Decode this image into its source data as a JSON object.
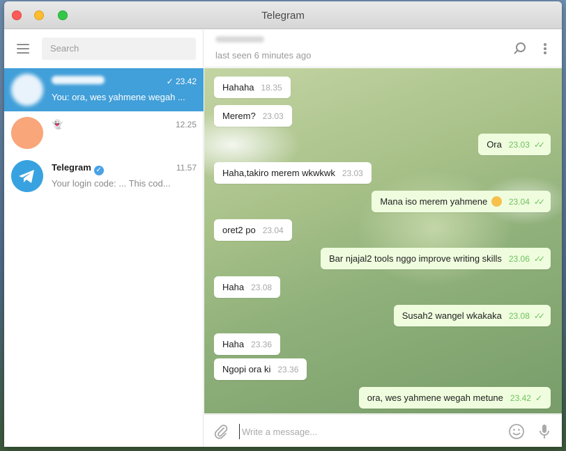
{
  "window": {
    "title": "Telegram"
  },
  "sidebar": {
    "search_placeholder": "Search",
    "chats": [
      {
        "name": "",
        "time": "23.42",
        "preview": "You: ora, wes yahmene wegah ...",
        "active": true,
        "avatar_color": "#ffffff"
      },
      {
        "name": "👻",
        "time": "12.25",
        "preview": "",
        "active": false,
        "avatar_color": "#f8a67a"
      },
      {
        "name": "Telegram",
        "time": "11.57",
        "preview": "Your login code: ...  This cod...",
        "active": false,
        "avatar_color": "#38a2e0"
      }
    ]
  },
  "chat": {
    "peer_status": "last seen 6 minutes ago",
    "messages": [
      {
        "dir": "in",
        "text": "Hahaha",
        "time": "18.35"
      },
      {
        "dir": "in",
        "text": "Merem?",
        "time": "23.03"
      },
      {
        "dir": "out",
        "text": "Ora",
        "time": "23.03",
        "status": "read"
      },
      {
        "dir": "in",
        "text": "Haha,takiro merem wkwkwk",
        "time": "23.03"
      },
      {
        "dir": "out",
        "text": "Mana iso merem yahmene",
        "time": "23.04",
        "status": "read",
        "emoji": true
      },
      {
        "dir": "in",
        "text": "oret2 po",
        "time": "23.04"
      },
      {
        "dir": "out",
        "text": "Bar njajal2 tools nggo improve writing skills",
        "time": "23.06",
        "status": "read"
      },
      {
        "dir": "in",
        "text": "Haha",
        "time": "23.08"
      },
      {
        "dir": "out",
        "text": "Susah2 wangel wkakaka",
        "time": "23.08",
        "status": "read"
      },
      {
        "dir": "in",
        "text": "Haha",
        "time": "23.36"
      },
      {
        "dir": "in",
        "text": "Ngopi ora ki",
        "time": "23.36"
      },
      {
        "dir": "out",
        "text": "ora, wes yahmene wegah metune",
        "time": "23.42",
        "status": "sent"
      }
    ],
    "composer_placeholder": "Write a message..."
  },
  "colors": {
    "accent": "#419fd9",
    "outgoing_bubble": "#effdde",
    "read_tick": "#6fc15f"
  }
}
